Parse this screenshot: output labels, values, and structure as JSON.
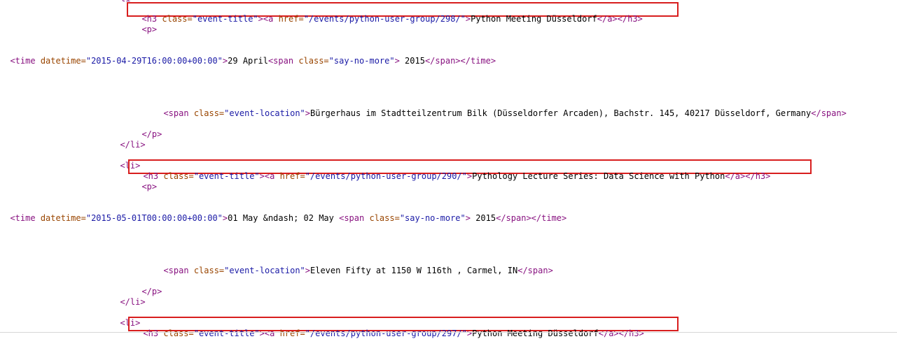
{
  "view": {
    "clipped_top": "li",
    "rule_color": "#d6d6d6"
  },
  "colors": {
    "tag": "#881280",
    "attribute": "#994500",
    "value": "#1a1aa6",
    "highlight": "#d81e1e"
  },
  "source": {
    "events": [
      {
        "h3_open": "<h3",
        "h3_attr": "class=",
        "h3_class": "\"event-title\"",
        "a_open": "><a",
        "a_attr": "href=",
        "href": "\"/events/python-user-group/298/\"",
        "a_close_bracket": ">",
        "title": "Python Meeting Düsseldorf",
        "close_tags": "</a></h3>",
        "p_open": "<p>",
        "time_open": "<time",
        "time_attr": "datetime=",
        "datetime": "\"2015-04-29T16:00:00+00:00\"",
        "time_close_bracket": ">",
        "date_text": "29 April",
        "span_open": "<span",
        "span_attr": "class=",
        "span_class": "\"say-no-more\"",
        "span_close_bracket": ">",
        "year": " 2015",
        "span_time_close": "</span></time>",
        "loc_open": "<span",
        "loc_attr": "class=",
        "loc_class": "\"event-location\"",
        "loc_close_bracket": ">",
        "location": "Bürgerhaus im Stadtteilzentrum Bilk (Düsseldorfer Arcaden), Bachstr. 145, 40217 Düsseldorf, Germany",
        "loc_close": "</span>",
        "p_close": "</p>",
        "li_close": "</li>",
        "li_open": "<li>"
      },
      {
        "h3_open": "<h3",
        "h3_attr": "class=",
        "h3_class": "\"event-title\"",
        "a_open": "><a",
        "a_attr": "href=",
        "href": "\"/events/python-user-group/290/\"",
        "a_close_bracket": ">",
        "title": "Pythology Lecture Series: Data Science with Python",
        "close_tags": "</a></h3>",
        "p_open": "<p>",
        "time_open": "<time",
        "time_attr": "datetime=",
        "datetime": "\"2015-05-01T00:00:00+00:00\"",
        "time_close_bracket": ">",
        "date_text": "01 May &ndash; 02 May ",
        "span_open": "<span",
        "span_attr": "class=",
        "span_class": "\"say-no-more\"",
        "span_close_bracket": ">",
        "year": " 2015",
        "span_time_close": "</span></time>",
        "loc_open": "<span",
        "loc_attr": "class=",
        "loc_class": "\"event-location\"",
        "loc_close_bracket": ">",
        "location": "Eleven Fifty at 1150 W 116th , Carmel, IN",
        "loc_close": "</span>",
        "p_close": "</p>",
        "li_close": "</li>",
        "li_open": "<li>"
      },
      {
        "h3_open": "<h3",
        "h3_attr": "class=",
        "h3_class": "\"event-title\"",
        "a_open": "><a",
        "a_attr": "href=",
        "href": "\"/events/python-user-group/297/\"",
        "a_close_bracket": ">",
        "title": "Python Meeting Düsseldorf",
        "close_tags": "</a></h3>"
      }
    ]
  }
}
